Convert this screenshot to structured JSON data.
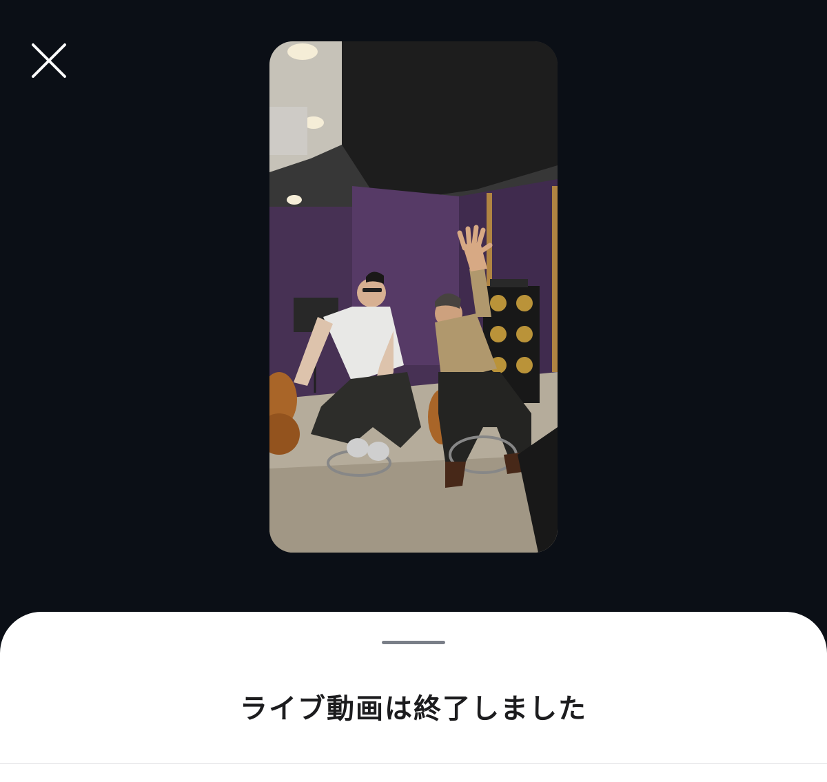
{
  "close": {
    "icon": "close-icon"
  },
  "video": {
    "icon": "live-video-thumbnail"
  },
  "sheet": {
    "title": "ライブ動画は終了しました"
  },
  "colors": {
    "background": "#0b0f16",
    "sheet": "#ffffff",
    "grabber": "#7a7f88",
    "title": "#1c1c1e"
  }
}
